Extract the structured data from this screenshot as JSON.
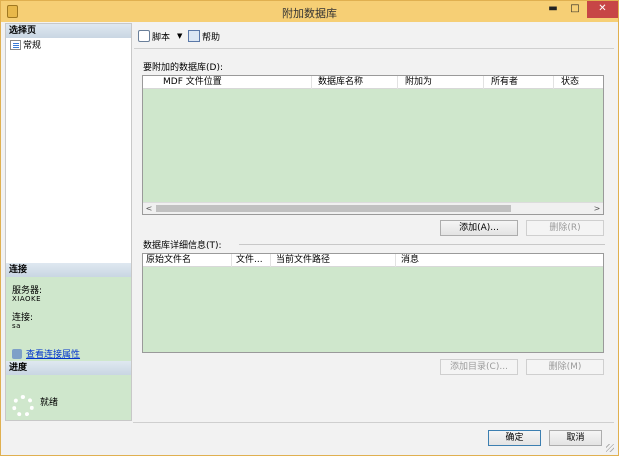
{
  "window": {
    "title": "附加数据库",
    "controls": {
      "minimize": "▬",
      "maximize": "□",
      "close": "✕"
    }
  },
  "left_pane": {
    "select_page_header": "选择页",
    "pages": [
      {
        "label": "常规",
        "icon": "general-page-icon"
      }
    ],
    "connection": {
      "header": "连接",
      "server_label": "服务器:",
      "server_value": "XIAOKE",
      "connection_label": "连接:",
      "connection_value": "sa",
      "view_link": "查看连接属性"
    },
    "progress": {
      "header": "进度",
      "status": "就绪"
    }
  },
  "toolbar": {
    "script_label": "脚本",
    "dropdown_glyph": "▼",
    "help_label": "帮助"
  },
  "databases_section": {
    "label": "要附加的数据库(D):",
    "columns": [
      "MDF 文件位置",
      "数据库名称",
      "附加为",
      "所有者",
      "状态"
    ],
    "rows": [],
    "scroll_left": "<",
    "scroll_right": ">",
    "add_button": "添加(A)...",
    "remove_button": "删除(R)"
  },
  "details_section": {
    "label": "数据库详细信息(T):",
    "columns": [
      "原始文件名",
      "文件...",
      "当前文件路径",
      "消息"
    ],
    "rows": [],
    "add_catalog_button": "添加目录(C)...",
    "remove_button": "删除(M)"
  },
  "footer": {
    "ok_button": "确定",
    "cancel_button": "取消"
  },
  "colors": {
    "title_bar": "#f6cf75",
    "grid_background": "#cfe7cc",
    "section_header": "#d4dfea",
    "link": "#0033cc",
    "close_button": "#c74646"
  }
}
